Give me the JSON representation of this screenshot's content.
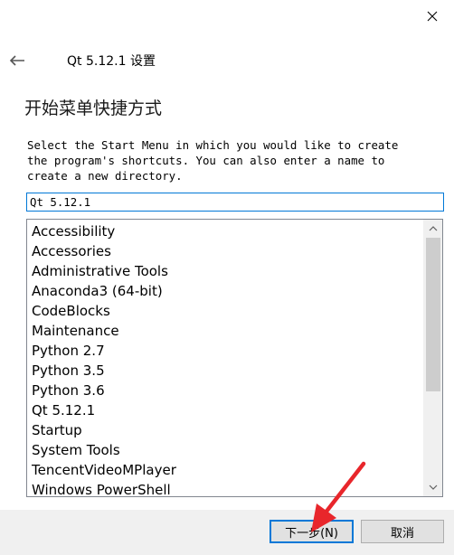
{
  "window": {
    "title": "Qt 5.12.1 设置",
    "close_icon": "close-icon",
    "back_icon": "back-arrow-icon"
  },
  "page": {
    "heading": "开始菜单快捷方式",
    "description": "Select the Start Menu in which you would like to create\nthe program's shortcuts. You can also enter a name to\ncreate a new directory."
  },
  "folder_input": {
    "value": "Qt 5.12.1"
  },
  "folder_list": {
    "items": [
      "Accessibility",
      "Accessories",
      "Administrative Tools",
      "Anaconda3 (64-bit)",
      "CodeBlocks",
      "Maintenance",
      "Python 2.7",
      "Python 3.5",
      "Python 3.6",
      "Qt 5.12.1",
      "Startup",
      "System Tools",
      "TencentVideoMPlayer",
      "Windows PowerShell"
    ],
    "scrollbar": {
      "up_icon": "chevron-up-icon",
      "down_icon": "chevron-down-icon"
    }
  },
  "buttons": {
    "next_label": "下一步(N)",
    "cancel_label": "取消"
  },
  "colors": {
    "accent": "#0078d7",
    "annotation": "#e8262b",
    "footer_bg": "#f0f0f0",
    "button_bg": "#e1e1e1"
  }
}
